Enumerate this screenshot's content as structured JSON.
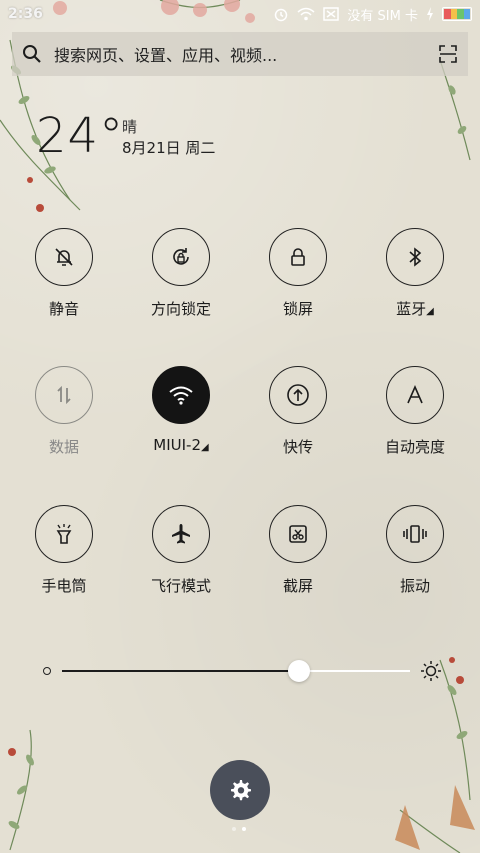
{
  "status_bar": {
    "time": "2:36",
    "carrier": "没有 SIM 卡"
  },
  "search": {
    "placeholder": "搜索网页、设置、应用、视频..."
  },
  "weather": {
    "temperature": "24°",
    "condition": "晴",
    "date": "8月21日 周二"
  },
  "toggles": [
    {
      "label": "静音",
      "icon": "bell-off-icon",
      "state": "off"
    },
    {
      "label": "方向锁定",
      "icon": "rotation-lock-icon",
      "state": "off"
    },
    {
      "label": "锁屏",
      "icon": "lock-icon",
      "state": "off"
    },
    {
      "label": "蓝牙",
      "icon": "bluetooth-icon",
      "state": "off",
      "has_arrow": true
    },
    {
      "label": "数据",
      "icon": "mobile-data-icon",
      "state": "disabled"
    },
    {
      "label": "MIUI-2",
      "icon": "wifi-icon",
      "state": "on",
      "has_arrow": true
    },
    {
      "label": "快传",
      "icon": "quick-share-icon",
      "state": "off"
    },
    {
      "label": "自动亮度",
      "icon": "auto-brightness-icon",
      "state": "off"
    },
    {
      "label": "手电筒",
      "icon": "flashlight-icon",
      "state": "off"
    },
    {
      "label": "飞行模式",
      "icon": "airplane-icon",
      "state": "off"
    },
    {
      "label": "截屏",
      "icon": "screenshot-icon",
      "state": "off"
    },
    {
      "label": "振动",
      "icon": "vibrate-icon",
      "state": "off"
    }
  ],
  "brightness": {
    "level": 0.68
  },
  "page_indicator": {
    "count": 2,
    "active": 1
  },
  "colors": {
    "background": "#e4e0d3",
    "active_tile": "#141414",
    "settings_button": "#4a4f5a"
  }
}
